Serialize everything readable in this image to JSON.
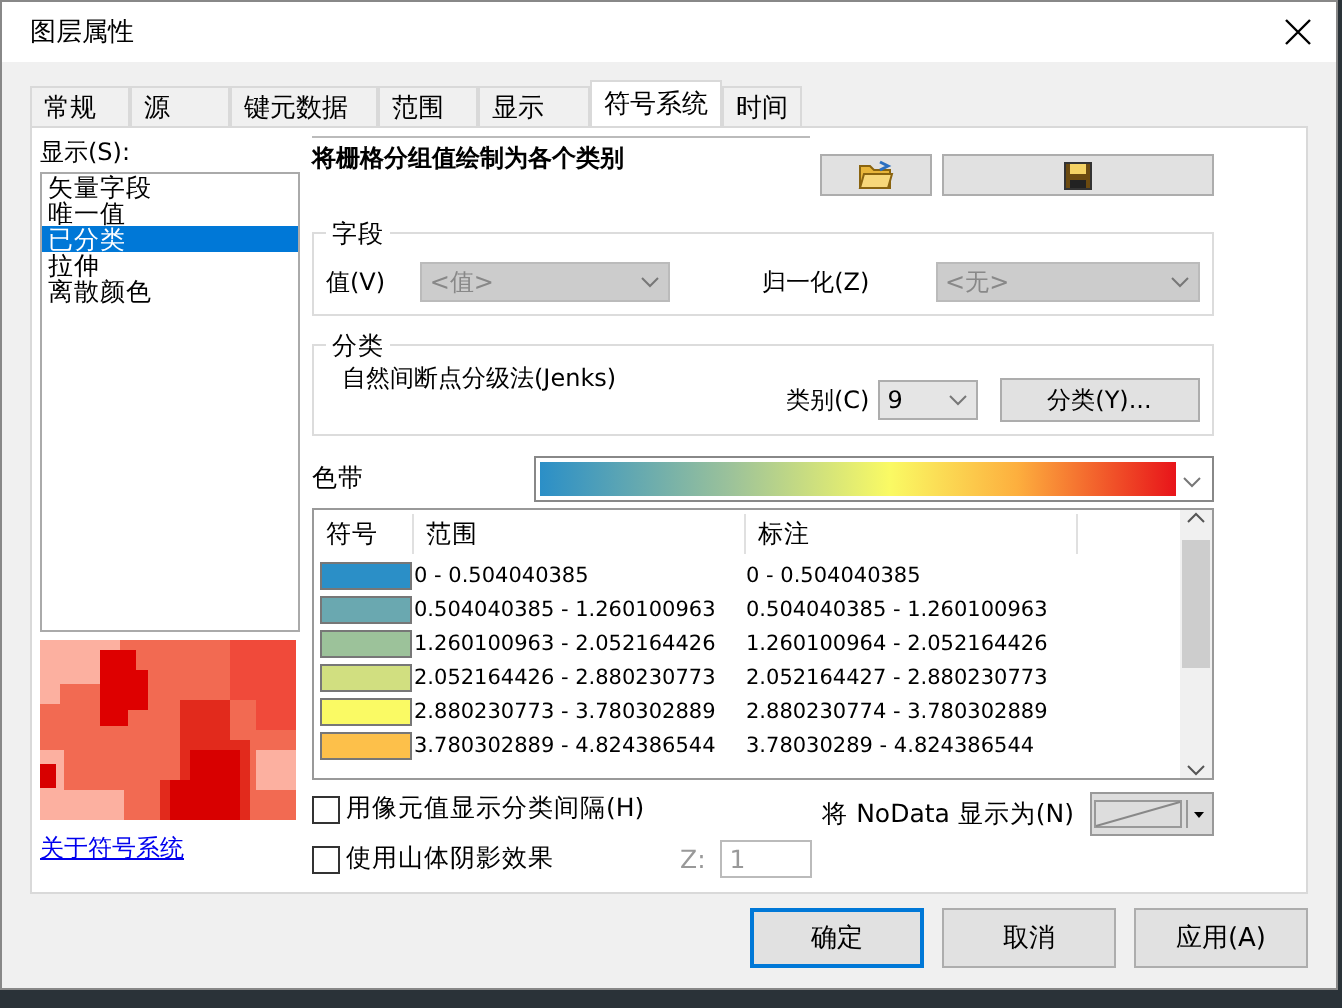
{
  "window": {
    "title": "图层属性"
  },
  "tabs": [
    {
      "label": "常规",
      "selected": false
    },
    {
      "label": "源",
      "selected": false
    },
    {
      "label": "键元数据",
      "selected": false
    },
    {
      "label": "范围",
      "selected": false
    },
    {
      "label": "显示",
      "selected": false
    },
    {
      "label": "符号系统",
      "selected": true
    },
    {
      "label": "时间",
      "selected": false
    }
  ],
  "show_panel": {
    "label": "显示(S):",
    "items": [
      {
        "label": "矢量字段",
        "selected": false
      },
      {
        "label": "唯一值",
        "selected": false
      },
      {
        "label": "已分类",
        "selected": true
      },
      {
        "label": "拉伸",
        "selected": false
      },
      {
        "label": "离散颜色",
        "selected": false
      }
    ],
    "link": "关于符号系统"
  },
  "heading": "将栅格分组值绘制为各个类别",
  "fields_group": {
    "title": "字段",
    "value": {
      "label": "值(V)",
      "value": "<值>",
      "disabled": true
    },
    "normalization": {
      "label": "归一化(Z)",
      "value": "<无>",
      "disabled": true
    }
  },
  "classification": {
    "title": "分类",
    "method": "自然间断点分级法(Jenks)",
    "classes_label": "类别(C)",
    "classes_value": "9",
    "button": "分类(Y)..."
  },
  "color_ramp": {
    "label": "色带"
  },
  "table": {
    "columns": [
      "符号",
      "范围",
      "标注"
    ],
    "rows": [
      {
        "color": "#2b8fc7",
        "range": "0 - 0.504040385",
        "label": "0 - 0.504040385"
      },
      {
        "color": "#6aa8b0",
        "range": "0.504040385 - 1.260100963",
        "label": "0.504040385 - 1.260100963"
      },
      {
        "color": "#9cc29a",
        "range": "1.260100963 - 2.052164426",
        "label": "1.260100964 - 2.052164426"
      },
      {
        "color": "#d1df80",
        "range": "2.052164426 - 2.880230773",
        "label": "2.052164427 - 2.880230773"
      },
      {
        "color": "#fafa64",
        "range": "2.880230773 - 3.780302889",
        "label": "2.880230774 - 3.780302889"
      },
      {
        "color": "#fdc04a",
        "range": "3.780302889 - 4.824386544",
        "label": "3.78030289 - 4.824386544"
      }
    ]
  },
  "options": [
    {
      "label": "用像元值显示分类间隔(H)",
      "checked": false
    },
    {
      "label": "使用山体阴影效果",
      "checked": false
    }
  ],
  "z": {
    "label": "Z:",
    "value": "1",
    "disabled": true
  },
  "nodata": {
    "label": "将 NoData 显示为(N)"
  },
  "buttons": [
    {
      "label": "确定",
      "default": true
    },
    {
      "label": "取消",
      "default": false
    },
    {
      "label": "应用(A)",
      "default": false
    }
  ]
}
